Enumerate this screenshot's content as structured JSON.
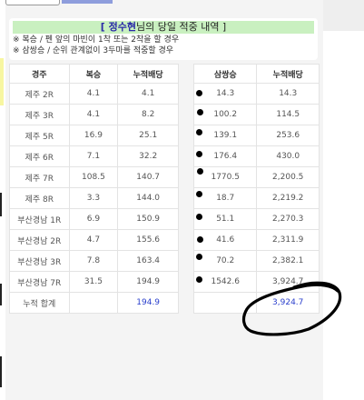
{
  "notice": {
    "bracket_open": "[ ",
    "user_name": "정수현",
    "title_suffix": "님의 당일 적중 내역 ]",
    "note1": "※ 복승 / 펜 앞의 마빈이 1착 또는 2착을 할 경우",
    "note2": "※ 삼쌍승 / 순위 관계없이 3두마를 적중할 경우"
  },
  "left_table": {
    "headers": [
      "경주",
      "복승",
      "누적배당"
    ],
    "rows": [
      [
        "제주 2R",
        "4.1",
        "4.1"
      ],
      [
        "제주 3R",
        "4.1",
        "8.2"
      ],
      [
        "제주 5R",
        "16.9",
        "25.1"
      ],
      [
        "제주 6R",
        "7.1",
        "32.2"
      ],
      [
        "제주 7R",
        "108.5",
        "140.7"
      ],
      [
        "제주 8R",
        "3.3",
        "144.0"
      ],
      [
        "부산경남 1R",
        "6.9",
        "150.9"
      ],
      [
        "부산경남 2R",
        "4.7",
        "155.6"
      ],
      [
        "부산경남 3R",
        "7.8",
        "163.4"
      ],
      [
        "부산경남 7R",
        "31.5",
        "194.9"
      ]
    ],
    "total_label": "누적 합계",
    "total_value": "194.9"
  },
  "right_table": {
    "headers": [
      "삼쌍승",
      "누적배당"
    ],
    "rows": [
      [
        "14.3",
        "14.3"
      ],
      [
        "100.2",
        "114.5"
      ],
      [
        "139.1",
        "253.6"
      ],
      [
        "176.4",
        "430.0"
      ],
      [
        "1770.5",
        "2,200.5"
      ],
      [
        "18.7",
        "2,219.2"
      ],
      [
        "51.1",
        "2,270.3"
      ],
      [
        "41.6",
        "2,311.9"
      ],
      [
        "70.2",
        "2,382.1"
      ],
      [
        "1542.6",
        "3,924.7"
      ]
    ],
    "total_value": "3,924.7"
  }
}
